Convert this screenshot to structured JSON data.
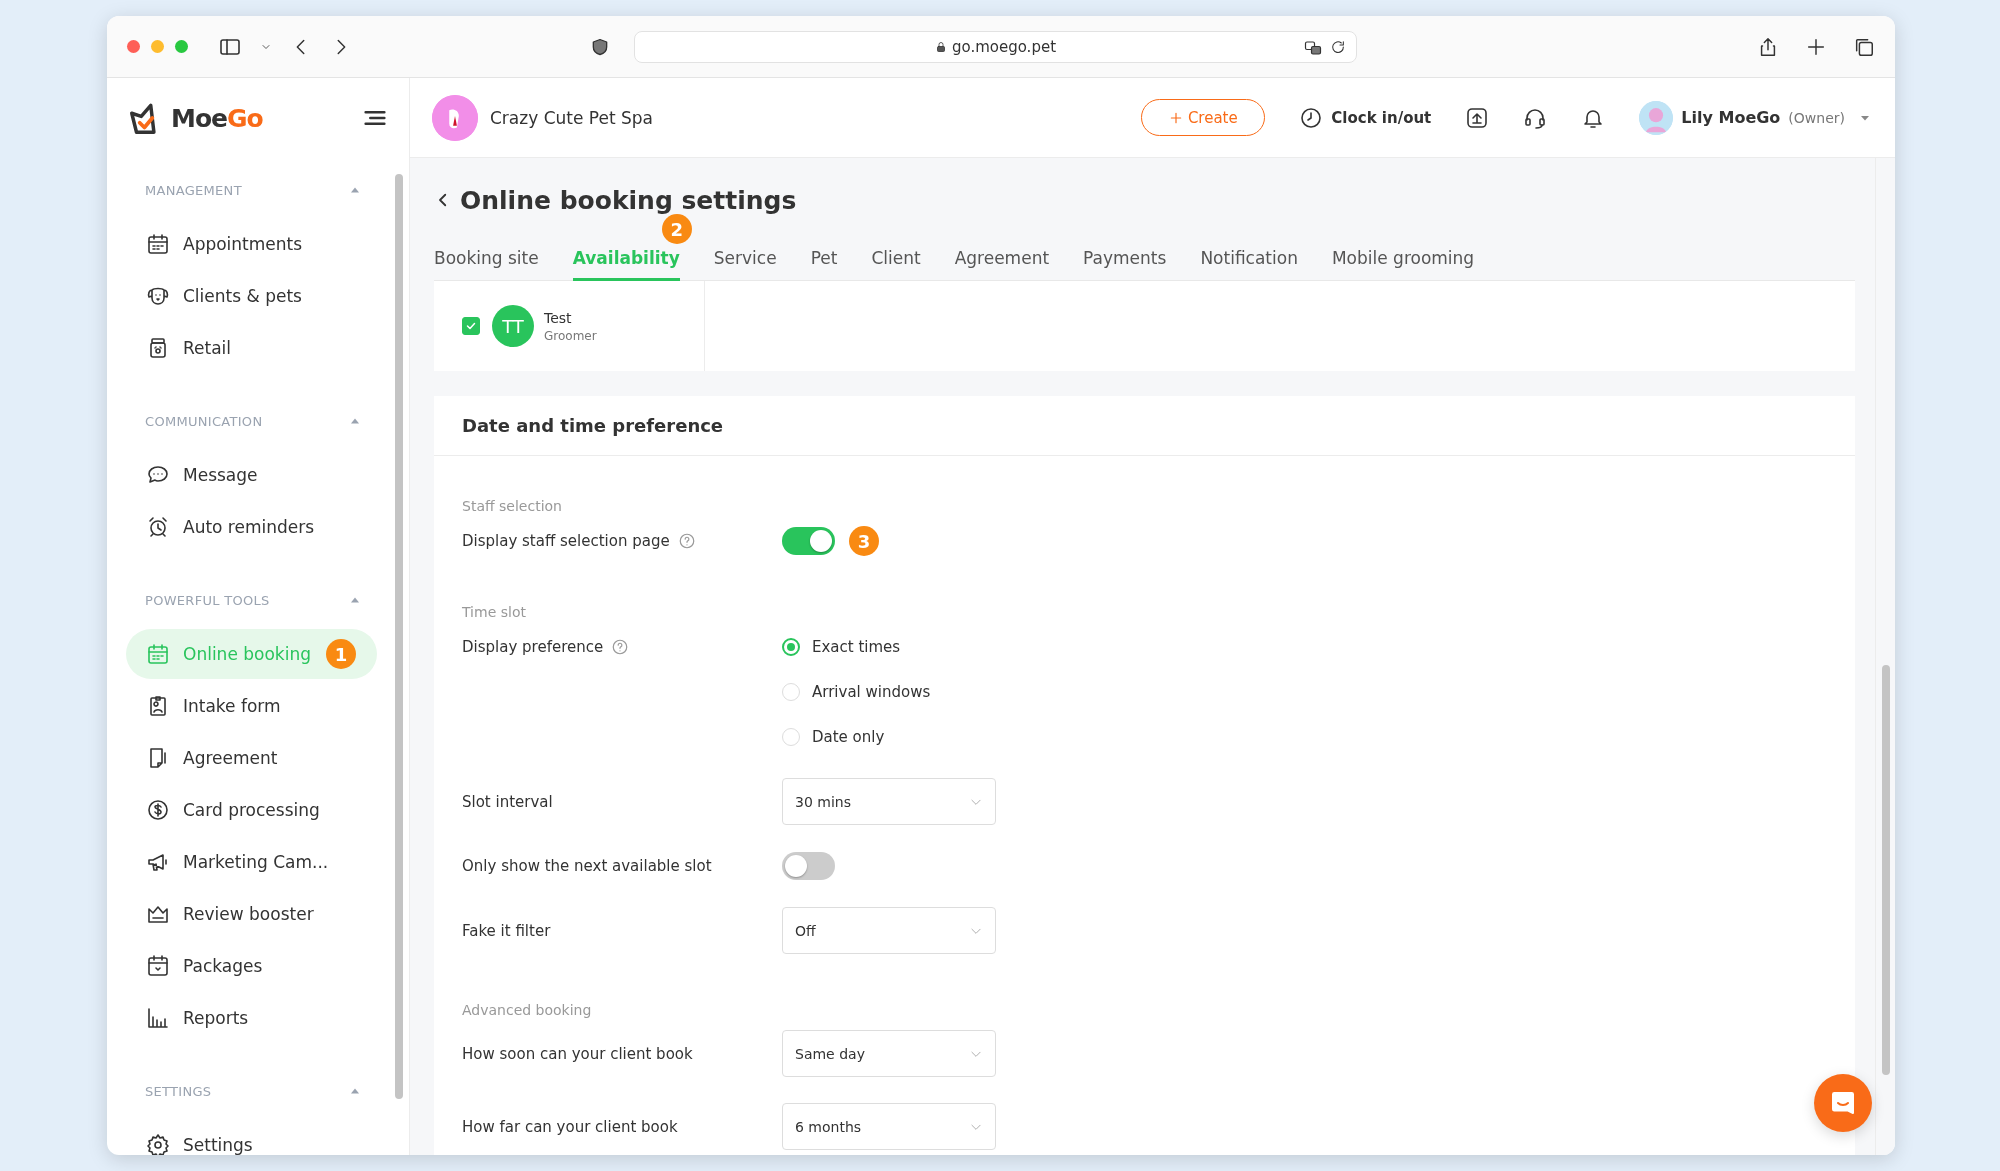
{
  "browser": {
    "url": "go.moego.pet"
  },
  "sidebar": {
    "logo": {
      "part_1": "Moe",
      "part_2": "Go"
    },
    "sections": [
      {
        "title": "MANAGEMENT",
        "expanded": true,
        "items": [
          {
            "label": "Appointments",
            "selected": false
          },
          {
            "label": "Clients & pets",
            "selected": false
          },
          {
            "label": "Retail",
            "selected": false
          }
        ]
      },
      {
        "title": "COMMUNICATION",
        "expanded": true,
        "items": [
          {
            "label": "Message",
            "selected": false
          },
          {
            "label": "Auto reminders",
            "selected": false
          }
        ]
      },
      {
        "title": "POWERFUL TOOLS",
        "expanded": true,
        "items": [
          {
            "label": "Online booking",
            "selected": true,
            "badge": "1"
          },
          {
            "label": "Intake form",
            "selected": false
          },
          {
            "label": "Agreement",
            "selected": false
          },
          {
            "label": "Card processing",
            "selected": false
          },
          {
            "label": "Marketing Cam...",
            "selected": false
          },
          {
            "label": "Review booster",
            "selected": false
          },
          {
            "label": "Packages",
            "selected": false
          },
          {
            "label": "Reports",
            "selected": false
          }
        ]
      },
      {
        "title": "SETTINGS",
        "expanded": true,
        "items": [
          {
            "label": "Settings",
            "selected": false
          }
        ]
      }
    ]
  },
  "header": {
    "business": "Crazy Cute Pet Spa",
    "create_button": "Create",
    "clock_button": "Clock in/out",
    "user": {
      "name": "Lily MoeGo",
      "role": "(Owner)"
    }
  },
  "page": {
    "title": "Online booking settings",
    "tabs": [
      {
        "label": "Booking site",
        "selected": false
      },
      {
        "label": "Availability",
        "selected": true,
        "badge": "2"
      },
      {
        "label": "Service",
        "selected": false
      },
      {
        "label": "Pet",
        "selected": false
      },
      {
        "label": "Client",
        "selected": false
      },
      {
        "label": "Agreement",
        "selected": false
      },
      {
        "label": "Payments",
        "selected": false
      },
      {
        "label": "Notification",
        "selected": false
      },
      {
        "label": "Mobile grooming",
        "selected": false
      }
    ]
  },
  "staff": [
    {
      "checked": true,
      "initials": "TT",
      "name": "Test",
      "role": "Groomer"
    }
  ],
  "preferences": {
    "title": "Date and time preference",
    "groups": [
      {
        "title": "Staff selection",
        "rows": [
          {
            "kind": "toggle",
            "label": "Display staff selection page",
            "help": true,
            "on": true,
            "badge": "3"
          }
        ]
      },
      {
        "title": "Time slot",
        "rows": [
          {
            "kind": "radio",
            "label": "Display preference",
            "help": true,
            "options": [
              {
                "label": "Exact times",
                "selected": true
              },
              {
                "label": "Arrival windows",
                "selected": false
              },
              {
                "label": "Date only",
                "selected": false
              }
            ]
          },
          {
            "kind": "select",
            "label": "Slot interval",
            "value": "30 mins"
          },
          {
            "kind": "toggle",
            "label": "Only show the next available slot",
            "on": false
          },
          {
            "kind": "select",
            "label": "Fake it filter",
            "value": "Off"
          }
        ]
      },
      {
        "title": "Advanced booking",
        "rows": [
          {
            "kind": "select",
            "label": "How soon can your client book",
            "value": "Same day"
          },
          {
            "kind": "select",
            "label": "How far can your client book",
            "value": "6 months"
          }
        ]
      }
    ]
  }
}
